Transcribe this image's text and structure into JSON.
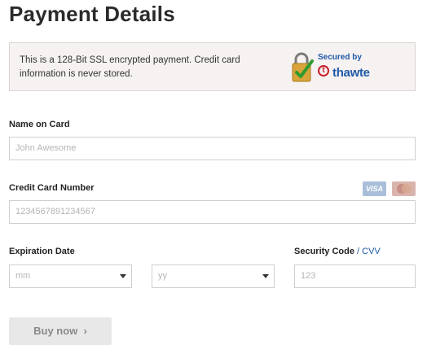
{
  "page": {
    "title": "Payment Details"
  },
  "notice": {
    "text": "This is a 128-Bit SSL encrypted payment. Credit card information is never stored.",
    "badge_secured": "Secured by",
    "badge_brand": "thawte",
    "badge_brand_letter": "t"
  },
  "name_field": {
    "label": "Name on Card",
    "placeholder": "John Awesome"
  },
  "card_field": {
    "label": "Credit Card Number",
    "placeholder": "1234567891234567",
    "visa_label": "VISA"
  },
  "expiration": {
    "label": "Expiration Date",
    "month_placeholder": "mm",
    "year_placeholder": "yy"
  },
  "security": {
    "label": "Security Code",
    "separator": "/",
    "cvv": "CVV",
    "placeholder": "123"
  },
  "buy_button": {
    "label": "Buy now",
    "chevron": "›"
  },
  "icons": [
    "lock-icon",
    "check-icon",
    "chevron-down-icon",
    "chevron-right-icon",
    "visa-icon",
    "mastercard-icon"
  ],
  "colors": {
    "accent": "#1e5aa8",
    "notice_bg": "#f7f2f2",
    "button_bg": "#e8e8e8",
    "brand_red": "#c8202a"
  }
}
